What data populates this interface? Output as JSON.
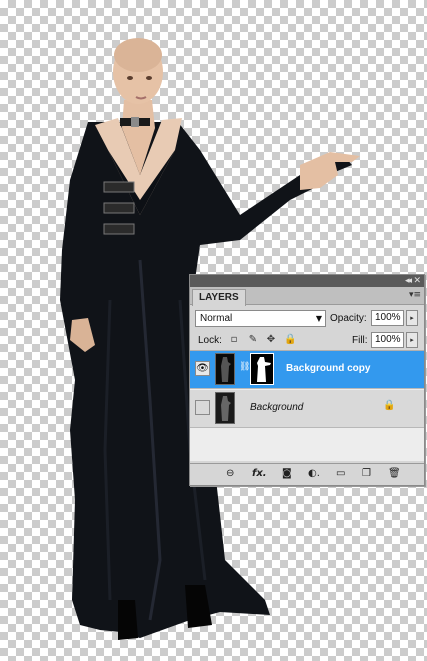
{
  "panel": {
    "tab_label": "LAYERS",
    "collapse_glyph": "◂◂",
    "close_glyph": "✕",
    "menu_glyph": "▾≡",
    "blend_mode": "Normal",
    "opacity_label": "Opacity:",
    "opacity_value": "100%",
    "lock_label": "Lock:",
    "fill_label": "Fill:",
    "fill_value": "100%",
    "slider_glyph": "▸",
    "lock_icons": [
      {
        "name": "lock-transparent-pixels-icon",
        "glyph": "▫"
      },
      {
        "name": "lock-image-pixels-icon",
        "glyph": "✎"
      },
      {
        "name": "lock-position-icon",
        "glyph": "✥"
      },
      {
        "name": "lock-all-icon",
        "glyph": "🔒"
      }
    ],
    "layers": [
      {
        "name": "Background copy",
        "visible": true,
        "selected": true,
        "has_mask": true,
        "locked": false
      },
      {
        "name": "Background",
        "visible": false,
        "selected": false,
        "has_mask": false,
        "locked": true
      }
    ],
    "bottom_icons": [
      {
        "name": "link-layers-icon",
        "glyph": "⊖"
      },
      {
        "name": "layer-style-icon",
        "glyph": "fx."
      },
      {
        "name": "add-mask-icon",
        "glyph": "◙"
      },
      {
        "name": "adjustment-layer-icon",
        "glyph": "◐."
      },
      {
        "name": "new-group-icon",
        "glyph": "▭"
      },
      {
        "name": "new-layer-icon",
        "glyph": "❐"
      },
      {
        "name": "delete-layer-icon",
        "glyph": "🗑"
      }
    ]
  },
  "colors": {
    "checker": "#cccccc",
    "selected_row": "#3399ee",
    "panel_bg": "#d6d6d6",
    "dress": "#101318",
    "skin": "#e4bfa3"
  }
}
